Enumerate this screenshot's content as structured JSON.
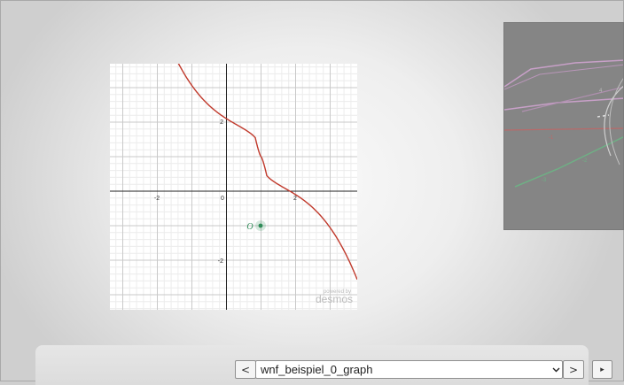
{
  "graph": {
    "x_ticks": [
      "-2",
      "0",
      "2"
    ],
    "y_ticks": [
      "2",
      "-2"
    ],
    "point_label": "O",
    "watermark_line1": "powered by",
    "watermark_line2": "desmos",
    "curve_color": "#c0392b",
    "point_color": "#2e8b57"
  },
  "thumbnail": {
    "labels": [
      "-1",
      "-2",
      "-3",
      "4"
    ]
  },
  "navigation": {
    "prev_label": "<",
    "next_label": ">",
    "play_label": "▸",
    "selected_graph": "wnf_beispiel_0_graph"
  }
}
